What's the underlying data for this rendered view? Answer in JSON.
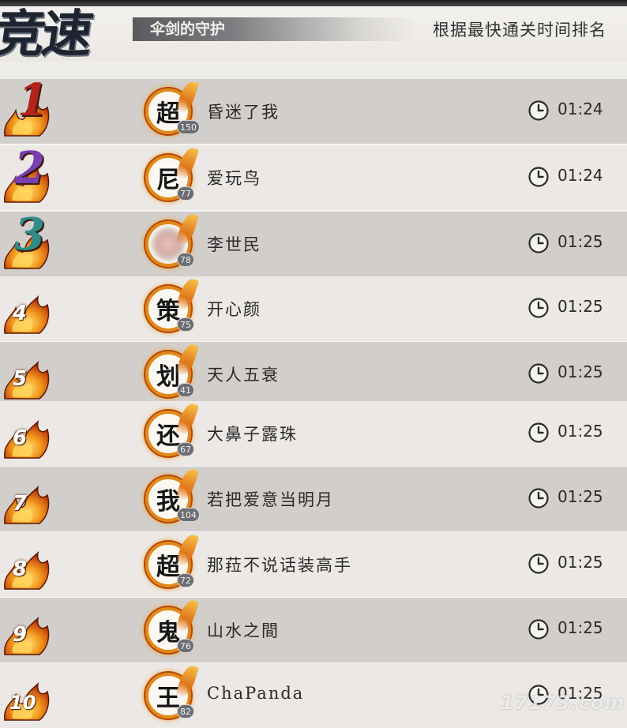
{
  "header": {
    "title": "竞速",
    "mode": "伞剑的守护",
    "ranking_description": "根据最快通关时间排名"
  },
  "leaderboard": [
    {
      "rank": "1",
      "avatar_char": "超",
      "level": "150",
      "name": "昏迷了我",
      "time": "01:24",
      "rank_color": "#b3231a"
    },
    {
      "rank": "2",
      "avatar_char": "尼",
      "level": "77",
      "name": "爱玩鸟",
      "time": "01:24",
      "rank_color": "#7a3fb0"
    },
    {
      "rank": "3",
      "avatar_char": "",
      "level": "78",
      "name": "李世民",
      "time": "01:25",
      "rank_color": "#2f8c87",
      "avatar_blurred": true
    },
    {
      "rank": "4",
      "avatar_char": "策",
      "level": "75",
      "name": "开心颜",
      "time": "01:25",
      "rank_color": "#ffffff"
    },
    {
      "rank": "5",
      "avatar_char": "划",
      "level": "41",
      "name": "天人五衰",
      "time": "01:25",
      "rank_color": "#ffffff"
    },
    {
      "rank": "6",
      "avatar_char": "还",
      "level": "67",
      "name": "大鼻子露珠",
      "time": "01:25",
      "rank_color": "#ffffff"
    },
    {
      "rank": "7",
      "avatar_char": "我",
      "level": "104",
      "name": "若把爱意当明月",
      "time": "01:25",
      "rank_color": "#ffffff"
    },
    {
      "rank": "8",
      "avatar_char": "超",
      "level": "72",
      "name": "那菈不说话装高手",
      "time": "01:25",
      "rank_color": "#ffffff"
    },
    {
      "rank": "9",
      "avatar_char": "鬼",
      "level": "76",
      "name": "山水之間",
      "time": "01:25",
      "rank_color": "#ffffff"
    },
    {
      "rank": "10",
      "avatar_char": "王",
      "level": "82",
      "name": "ChaPanda",
      "time": "01:25",
      "rank_color": "#ffffff"
    }
  ],
  "icons": {
    "time": "clock-icon",
    "rank_decoration": "flame-icon"
  },
  "watermark": "17173.com"
}
